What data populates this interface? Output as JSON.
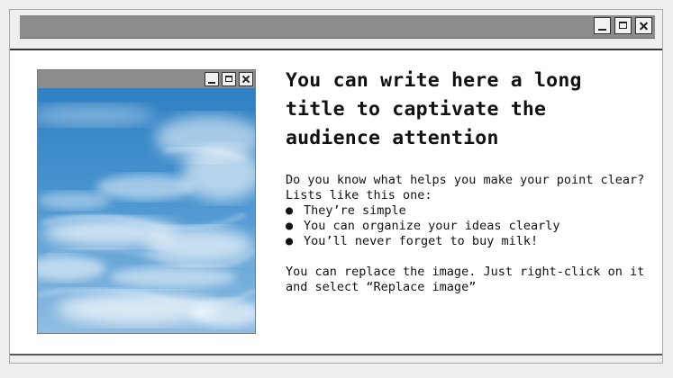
{
  "outer_window": {
    "controls": {
      "minimize": "minimize-icon",
      "maximize": "maximize-icon",
      "close": "close-icon"
    }
  },
  "image_window": {
    "image": "sky-with-clouds",
    "controls": {
      "minimize": "minimize-icon",
      "maximize": "maximize-icon",
      "close": "close-icon"
    }
  },
  "content": {
    "title": "You can write here a long title to captivate the audience attention",
    "intro_line1": "Do you know what helps you make your point clear?",
    "intro_line2": "Lists like this one:",
    "bullet_char": "●",
    "bullets": [
      "They’re simple",
      "You can organize your ideas clearly",
      "You’ll never forget to buy milk!"
    ],
    "footer": "You can replace the image. Just right-click on it and select “Replace image”"
  },
  "colors": {
    "page_background": "#eeeeee",
    "titlebar": "#8c8c8c",
    "window_background": "#ffffff",
    "text": "#111111",
    "sky_blue": "#3b86c6"
  }
}
